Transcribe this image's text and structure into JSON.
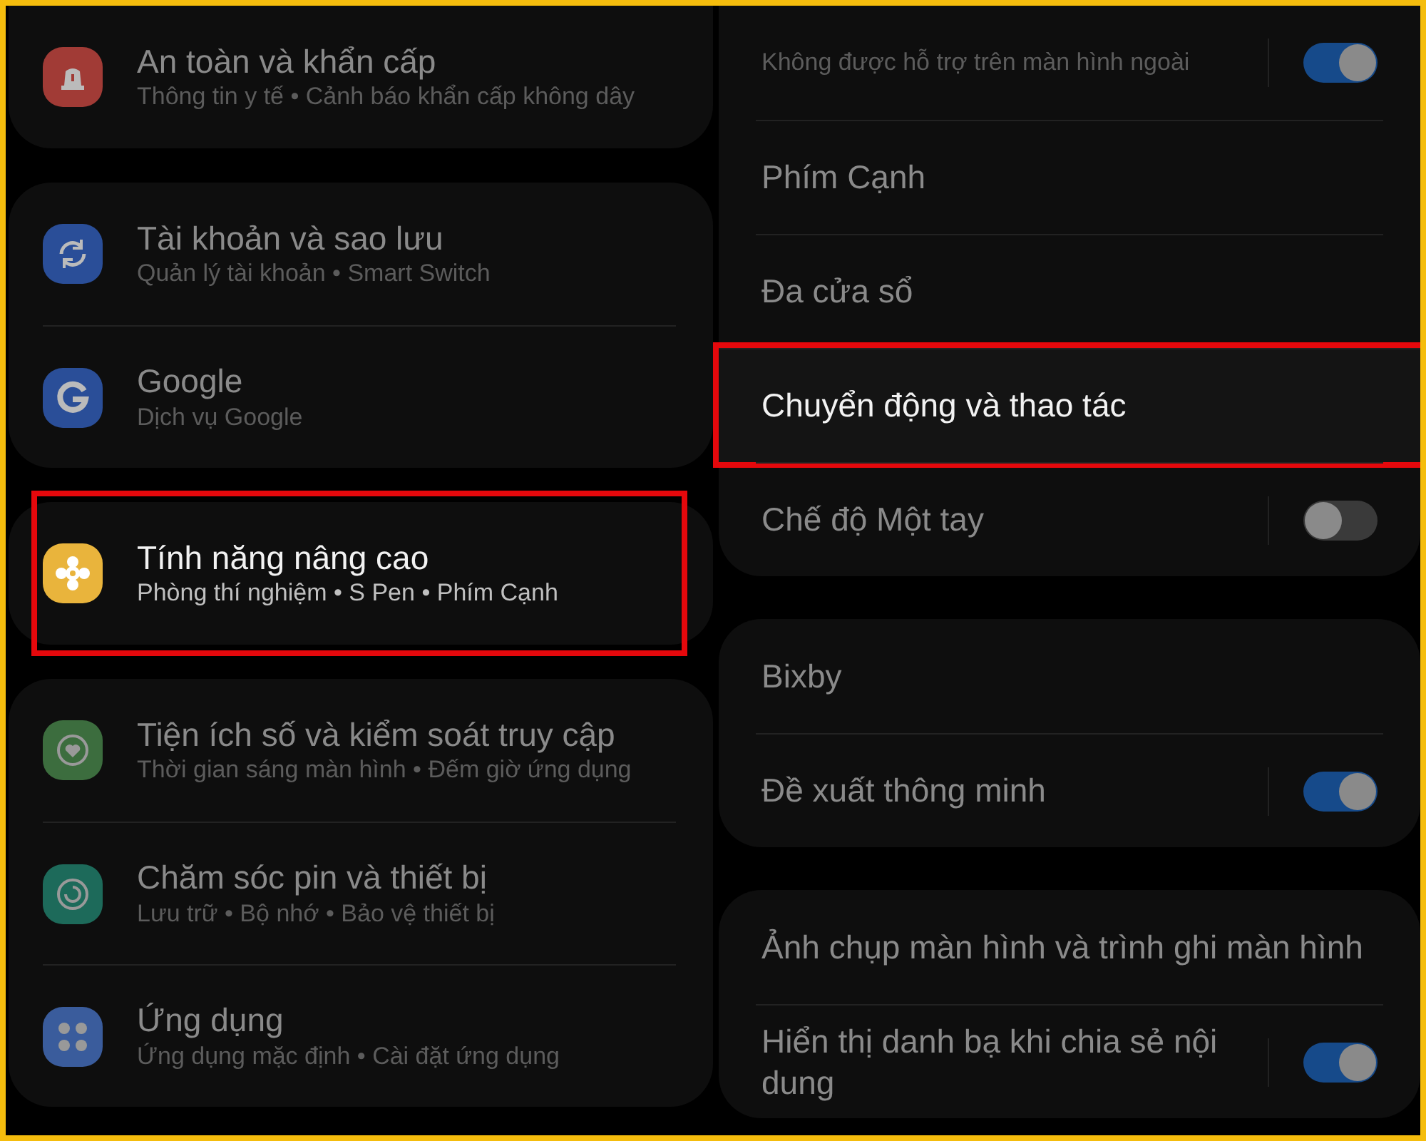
{
  "left_groups": [
    {
      "items": [
        {
          "title": "An toàn và khẩn cấp",
          "subtitle": "Thông tin y tế • Cảnh báo khẩn cấp không dây",
          "color": "#a13b36",
          "highlighted": false
        }
      ]
    },
    {
      "items": [
        {
          "title": "Tài khoản và sao lưu",
          "subtitle": "Quản lý tài khoản • Smart Switch",
          "color": "#2a4e98",
          "highlighted": false
        },
        {
          "title": "Google",
          "subtitle": "Dịch vụ Google",
          "color": "#2a4e98",
          "highlighted": false
        }
      ]
    },
    {
      "items": [
        {
          "title": "Tính năng nâng cao",
          "subtitle": "Phòng thí nghiệm • S Pen • Phím Cạnh",
          "color": "#e9b43c",
          "highlighted": true
        }
      ]
    },
    {
      "items": [
        {
          "title": "Tiện ích số và kiểm soát truy cập",
          "subtitle": "Thời gian sáng màn hình • Đếm giờ ứng dụng",
          "color": "#3c6d3e",
          "highlighted": false
        },
        {
          "title": "Chăm sóc pin và thiết bị",
          "subtitle": "Lưu trữ • Bộ nhớ • Bảo vệ thiết bị",
          "color": "#1d6a5a",
          "highlighted": false
        },
        {
          "title": "Ứng dụng",
          "subtitle": "Ứng dụng mặc định • Cài đặt ứng dụng",
          "color": "#3a5c9c",
          "highlighted": false
        }
      ]
    }
  ],
  "right_groups": [
    {
      "items": [
        {
          "subtitle": "Không được hỗ trợ trên màn hình ngoài",
          "toggle": {
            "on": true
          },
          "highlighted": false
        },
        {
          "title": "Phím Cạnh",
          "highlighted": false
        },
        {
          "title": "Đa cửa sổ",
          "highlighted": false
        },
        {
          "title": "Chuyển động và thao tác",
          "highlighted": true
        },
        {
          "title": "Chế độ Một tay",
          "toggle": {
            "on": false
          },
          "highlighted": false
        }
      ]
    },
    {
      "items": [
        {
          "title": "Bixby",
          "highlighted": false
        },
        {
          "title": "Đề xuất thông minh",
          "toggle": {
            "on": true
          },
          "highlighted": false
        }
      ]
    },
    {
      "items": [
        {
          "title": "Ảnh chụp màn hình và trình ghi màn hình",
          "highlighted": false
        },
        {
          "title": "Hiển thị danh bạ khi chia sẻ nội dung",
          "toggle": {
            "on": true
          },
          "highlighted": false
        }
      ]
    }
  ]
}
